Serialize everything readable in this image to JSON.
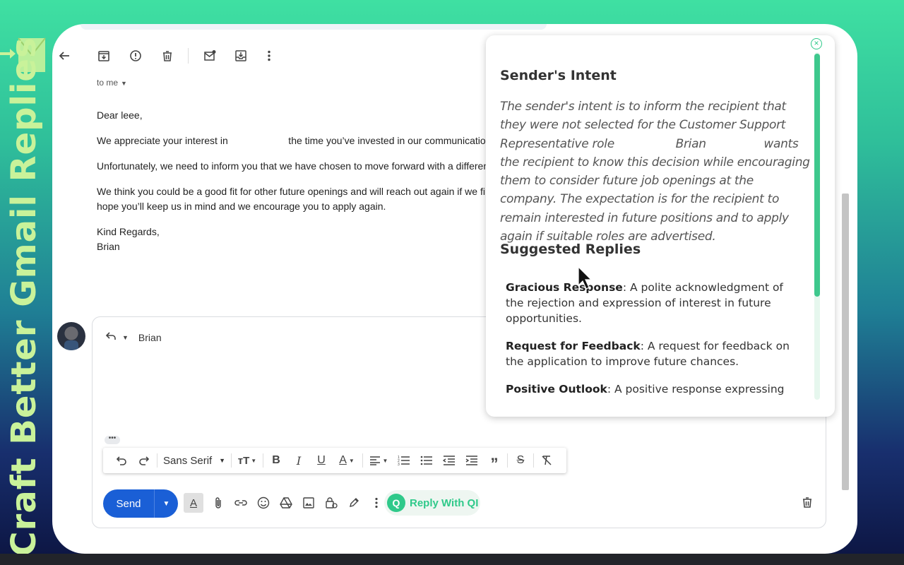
{
  "side_promo": {
    "text": "Craft Better Gmail Replies",
    "color": "#c9f29a"
  },
  "email": {
    "recipient_line": "to me",
    "greeting": "Dear leee,",
    "paragraph_1": "We appreciate your interest in                      the time you’ve invested in our communication regar",
    "paragraph_2": "Unfortunately, we need to inform you that we have chosen to move forward with a different canc",
    "paragraph_3": "We think you could be a good fit for other future openings and will reach out again if we find a g",
    "paragraph_3b": "hope you’ll keep us in mind and we encourage you to apply again.",
    "closing": "Kind Regards,",
    "signature": "Brian"
  },
  "reply": {
    "to_name": "Brian",
    "send_label": "Send",
    "font_name": "Sans Serif",
    "qi_label": "Reply With QI"
  },
  "panel": {
    "intent_heading": "Sender's Intent",
    "intent_text": "The sender's intent is to inform the recipient that they were not selected for the Customer Support Representative role                 Brian                wants the recipient to know this decision while encouraging them to consider future job openings at the company. The expectation is for the recipient to remain interested in future positions and to apply again if suitable roles are advertised.",
    "replies_heading": "Suggested Replies",
    "replies": [
      {
        "title": "Gracious Response",
        "desc": ": A polite acknowledgment of the rejection and expression of interest in future opportunities."
      },
      {
        "title": "Request for Feedback",
        "desc": ": A request for feedback on the application to improve future chances."
      },
      {
        "title": "Positive Outlook",
        "desc": ": A positive response expressing"
      }
    ]
  },
  "colors": {
    "accent": "#2fc98a",
    "send": "#1a5fd6"
  },
  "icons": [
    "back-icon",
    "archive-icon",
    "report-icon",
    "delete-icon",
    "mark-unread-icon",
    "move-to-icon",
    "more-icon"
  ]
}
